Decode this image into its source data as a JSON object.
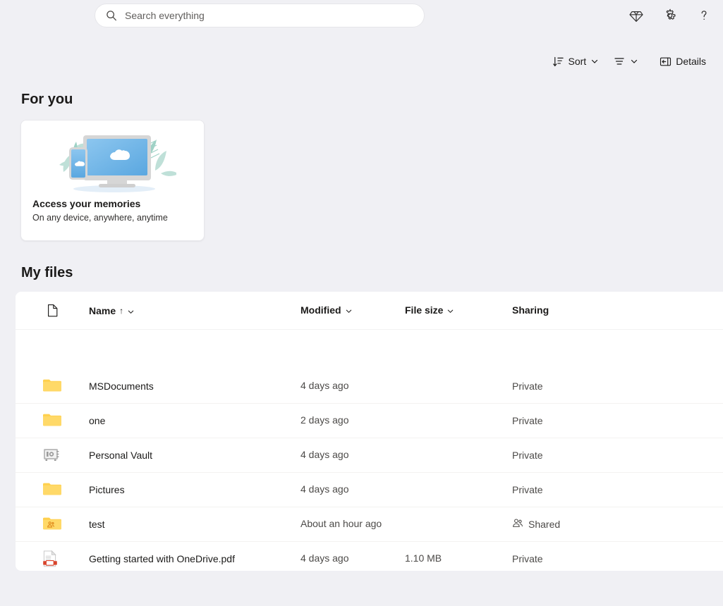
{
  "app": {
    "background_color": "#f0f0f4",
    "accent_color": "#0f6cbd"
  },
  "search": {
    "placeholder": "Search everything",
    "value": "",
    "icon": "search-icon"
  },
  "top_actions": [
    {
      "name": "premium-diamond-icon",
      "label": "Premium"
    },
    {
      "name": "settings-gear-icon",
      "label": "Settings"
    },
    {
      "name": "help-question-icon",
      "label": "Help"
    }
  ],
  "toolbar": {
    "sort_label": "Sort",
    "sort_icon": "sort-descending-icon",
    "view_icon": "list-view-icon",
    "details_label": "Details",
    "details_icon": "details-panel-icon"
  },
  "for_you": {
    "heading": "For you",
    "card": {
      "title": "Access your memories",
      "subtitle": "On any device, anywhere, anytime",
      "illustration": "devices-cloud-illustration"
    }
  },
  "my_files": {
    "heading": "My files",
    "columns": {
      "icon": "file-type-icon",
      "name": "Name",
      "name_sort": "↑",
      "modified": "Modified",
      "file_size": "File size",
      "sharing": "Sharing"
    },
    "rows": [
      {
        "icon": "folder-icon",
        "name": "MSDocuments",
        "modified": "4 days ago",
        "size": "",
        "sharing": "Private",
        "sharing_icon": ""
      },
      {
        "icon": "folder-icon",
        "name": "one",
        "modified": "2 days ago",
        "size": "",
        "sharing": "Private",
        "sharing_icon": ""
      },
      {
        "icon": "personal-vault-icon",
        "name": "Personal Vault",
        "modified": "4 days ago",
        "size": "",
        "sharing": "Private",
        "sharing_icon": ""
      },
      {
        "icon": "folder-icon",
        "name": "Pictures",
        "modified": "4 days ago",
        "size": "",
        "sharing": "Private",
        "sharing_icon": ""
      },
      {
        "icon": "shared-folder-icon",
        "name": "test",
        "modified": "About an hour ago",
        "size": "",
        "sharing": "Shared",
        "sharing_icon": "people-icon"
      },
      {
        "icon": "pdf-file-icon",
        "name": "Getting started with OneDrive.pdf",
        "modified": "4 days ago",
        "size": "1.10 MB",
        "sharing": "Private",
        "sharing_icon": ""
      }
    ]
  }
}
